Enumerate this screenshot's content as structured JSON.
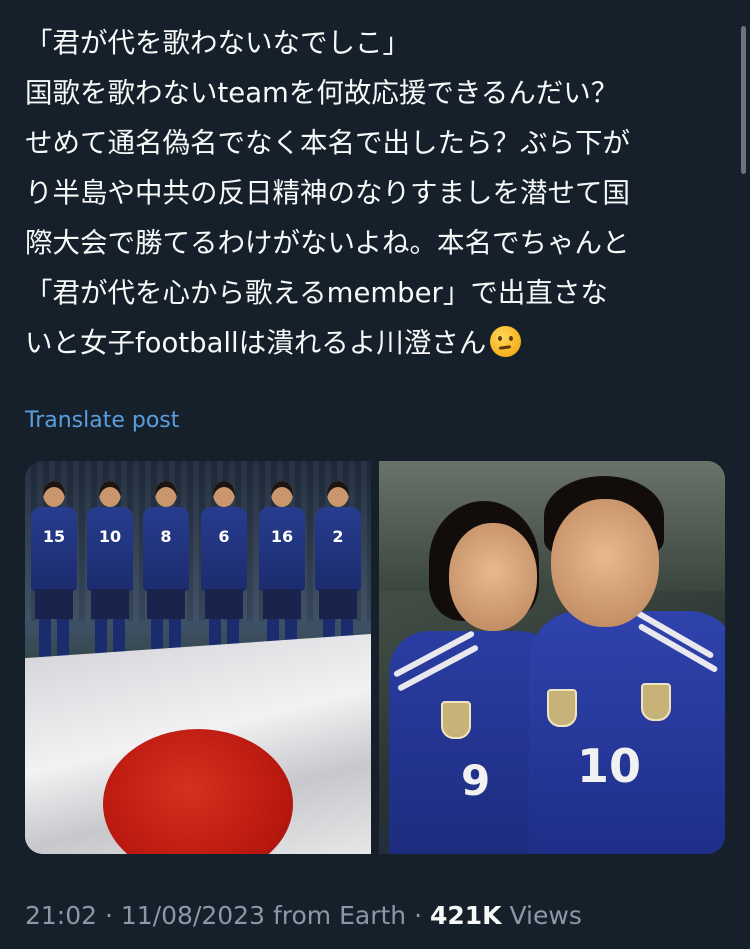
{
  "post": {
    "text": "「君が代を歌わないなでしこ」\n国歌を歌わないteamを何故応援できるんだい？\nせめて通名偽名でなく本名で出したら？ぶら下が\nり半島や中共の反日精神のなりすましを潜せて国\n際大会で勝てるわけがないよね。本名でちゃんと\n「君が代を心から歌えるmember」で出直さな\nいと女子footballは潰れるよ川澄さん",
    "emoji": "thinking-face",
    "translate_label": "Translate post"
  },
  "media": {
    "left_jersey_numbers": [
      "15",
      "10",
      "8",
      "6",
      "16",
      "2"
    ],
    "right_jersey_numbers": [
      "9",
      "10"
    ]
  },
  "meta": {
    "time": "21:02",
    "date": "11/08/2023",
    "source": "from Earth",
    "views_count": "421K",
    "views_label": "Views",
    "separator": "·"
  },
  "colors": {
    "background": "#15202b",
    "text": "#f7f9f9",
    "link": "#5b9ee0",
    "muted": "#8b98a5"
  }
}
